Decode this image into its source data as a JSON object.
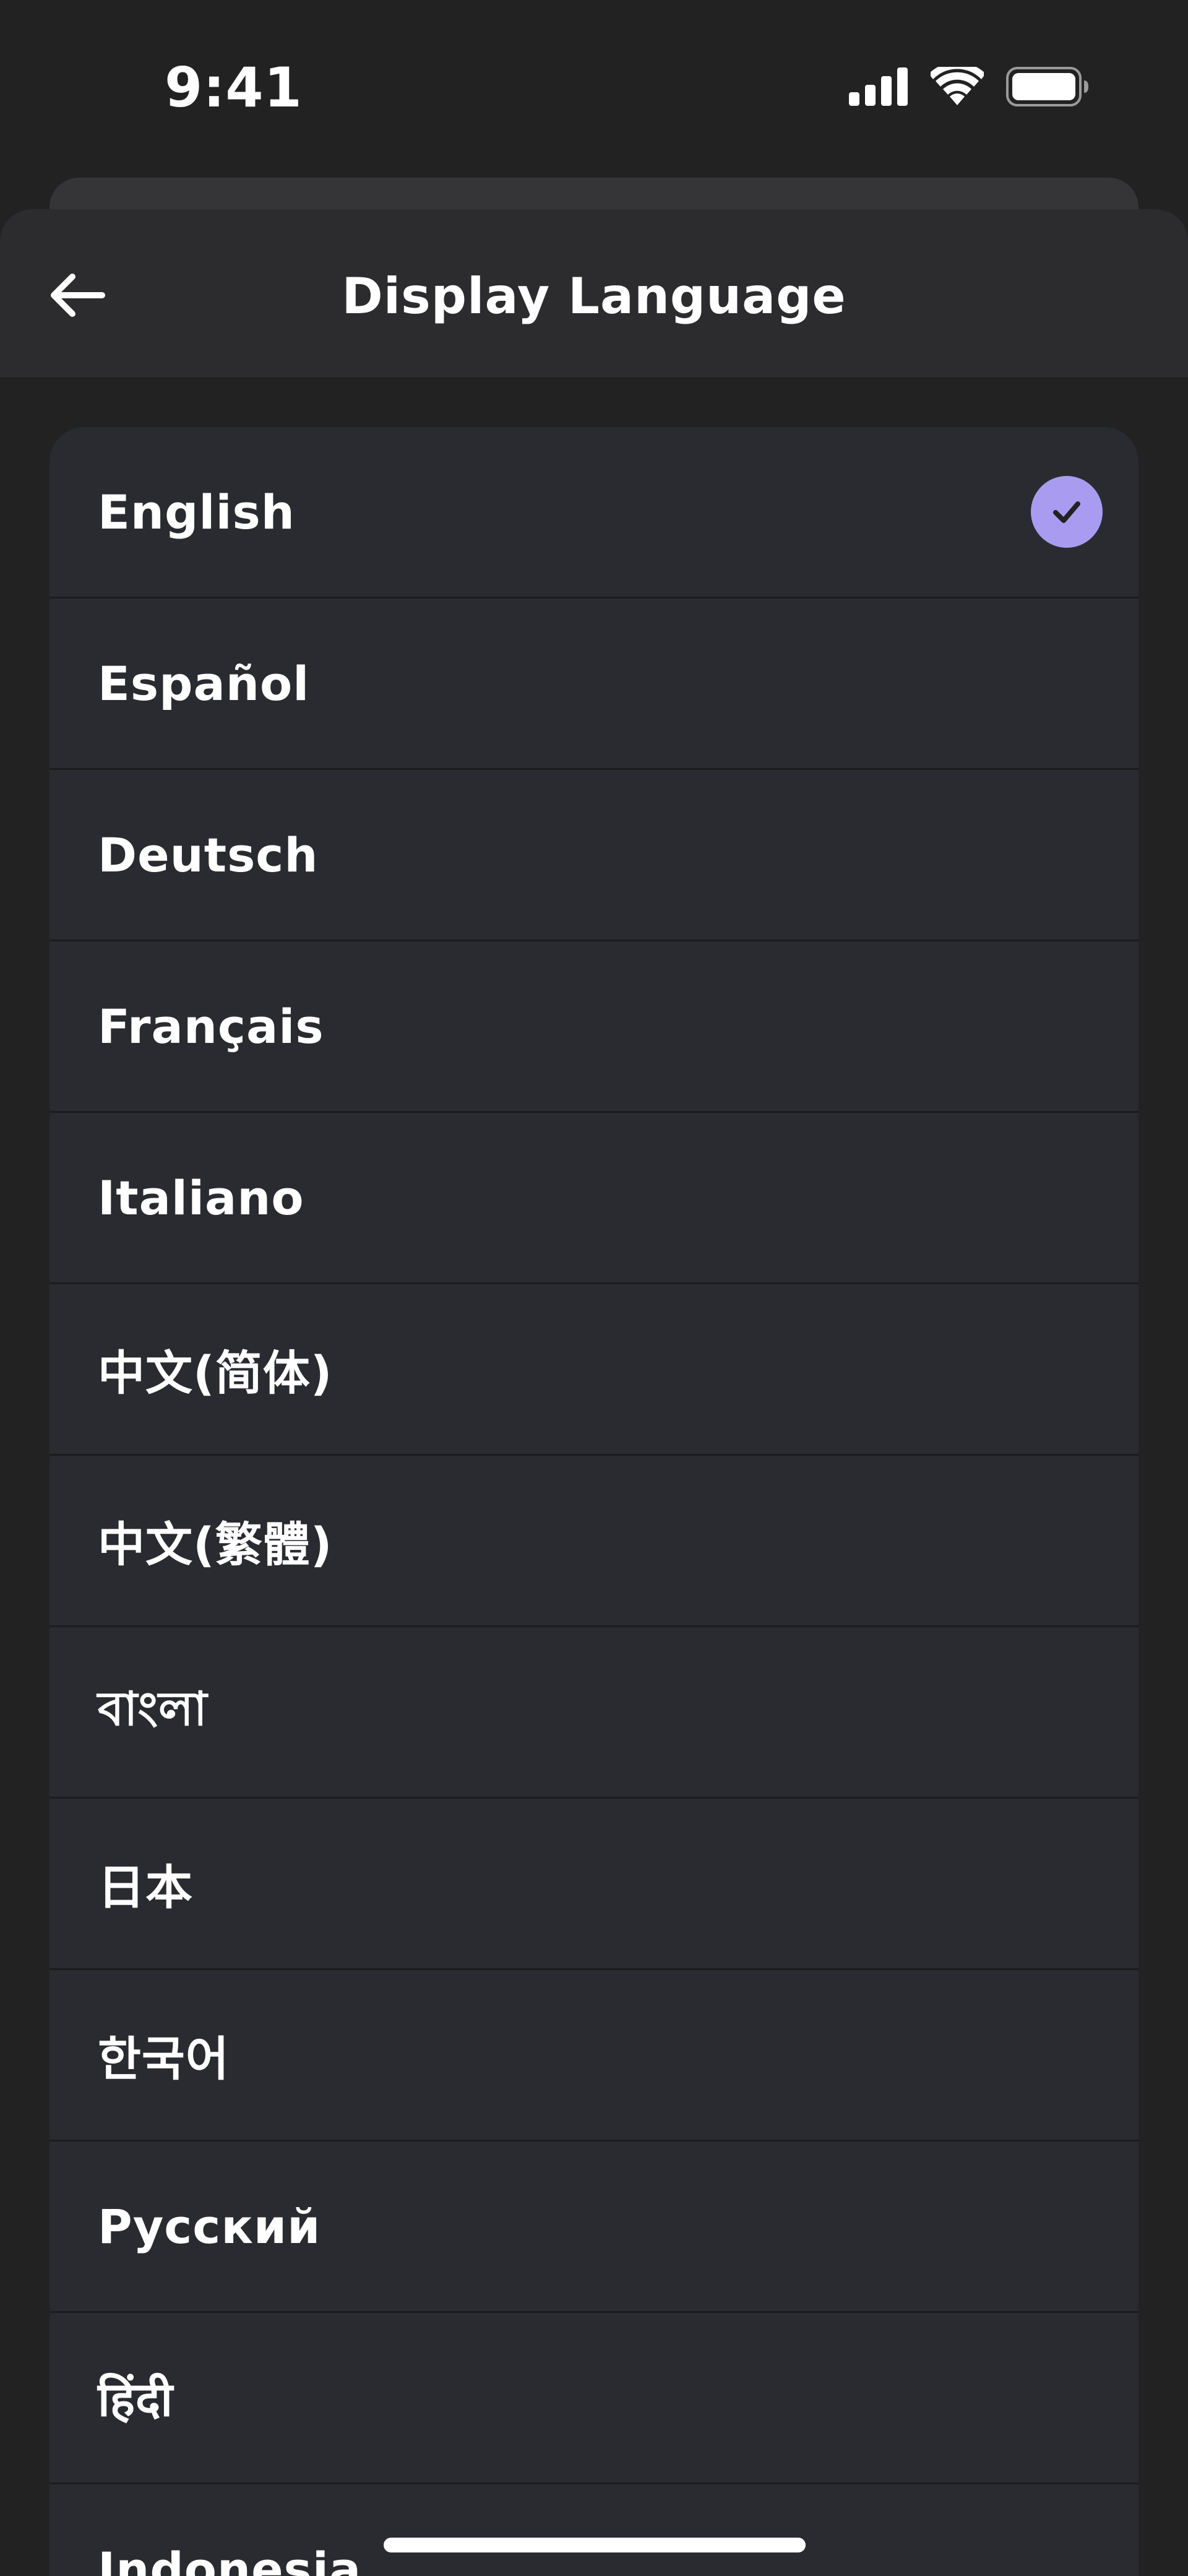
{
  "status_bar": {
    "time": "9:41",
    "icons": [
      "cellular-signal-icon",
      "wifi-icon",
      "battery-icon"
    ]
  },
  "header": {
    "title": "Display Language",
    "back_icon": "arrow-left-icon"
  },
  "languages": [
    {
      "label": "English",
      "selected": true
    },
    {
      "label": "Español",
      "selected": false
    },
    {
      "label": "Deutsch",
      "selected": false
    },
    {
      "label": "Français",
      "selected": false
    },
    {
      "label": "Italiano",
      "selected": false
    },
    {
      "label": "中文(简体)",
      "selected": false
    },
    {
      "label": "中文(繁體)",
      "selected": false
    },
    {
      "label": "বাংলা",
      "selected": false
    },
    {
      "label": "日本",
      "selected": false
    },
    {
      "label": "한국어",
      "selected": false
    },
    {
      "label": "Русский",
      "selected": false
    },
    {
      "label": "हिंदी",
      "selected": false
    },
    {
      "label": "Indonesia",
      "selected": false
    }
  ],
  "colors": {
    "background": "#222223",
    "header": "#2c2c2e",
    "card": "#2a2b30",
    "accent": "#a99cf0",
    "checkmark": "#222223",
    "text": "#ffffff"
  }
}
